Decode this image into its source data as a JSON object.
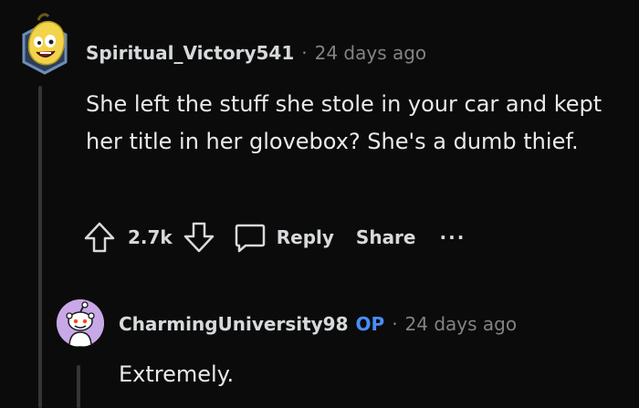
{
  "comments": [
    {
      "username": "Spiritual_Victory541",
      "separator": "·",
      "time": "24 days ago",
      "body": "She left the stuff she stole in your car and kept her title in her glovebox? She's a dumb thief.",
      "vote_count": "2.7k",
      "reply_label": "Reply",
      "share_label": "Share",
      "more_label": "···"
    },
    {
      "username": "CharmingUniversity98",
      "op_badge": "OP",
      "separator": "·",
      "time": "24 days ago",
      "body": "Extremely."
    }
  ],
  "colors": {
    "background": "#0b0b0b",
    "text": "#d7dadc",
    "muted": "#818384",
    "op": "#4a8df7",
    "thread_line": "#343536",
    "avatar2_bg": "#c9a8e8"
  }
}
